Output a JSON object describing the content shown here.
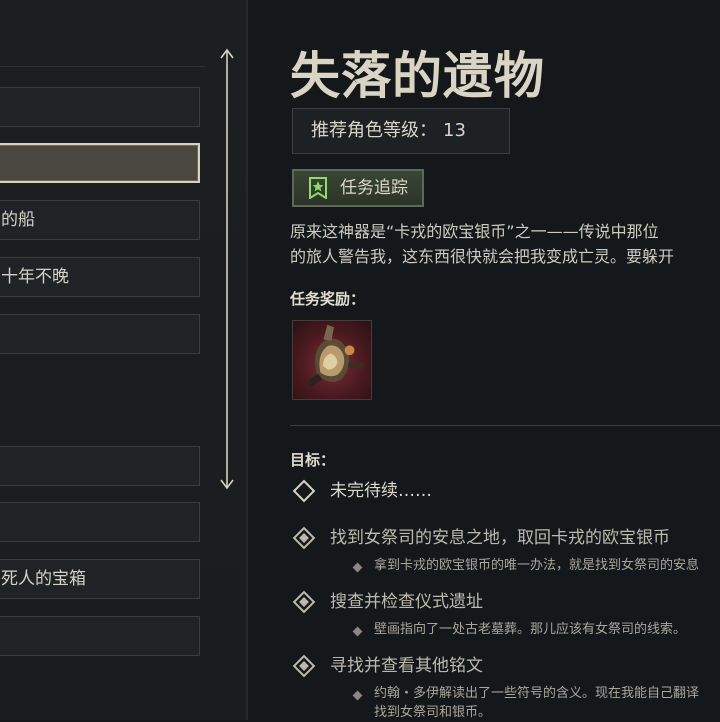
{
  "quest_list": {
    "items": [
      {
        "label": ""
      },
      {
        "label": ""
      },
      {
        "label": "的船"
      },
      {
        "label": "十年不晚"
      },
      {
        "label": ""
      },
      {
        "label": ""
      },
      {
        "label": ""
      },
      {
        "label": "死人的宝箱"
      },
      {
        "label": ""
      }
    ],
    "selected_index": 1
  },
  "quest": {
    "title": "失落的遗物",
    "level_label": "推荐角色等级：",
    "level_value": "13",
    "track_button": "任务追踪",
    "description_line1": "原来这神器是“卡戎的欧宝银币”之一——传说中那位",
    "description_line2": "的旅人警告我，这东西很快就会把我变成亡灵。要躲开",
    "rewards_label": "任务奖励：",
    "reward_icon": "coin-relic-icon",
    "objectives_label": "目标：",
    "objectives": [
      {
        "text": "未完待续……",
        "sub": ""
      },
      {
        "text": "找到女祭司的安息之地，取回卡戎的欧宝银币",
        "sub": "拿到卡戎的欧宝银币的唯一办法，就是找到女祭司的安息"
      },
      {
        "text": "搜查并检查仪式遗址",
        "sub": "壁画指向了一处古老墓葬。那儿应该有女祭司的线索。"
      },
      {
        "text": "寻找并查看其他铭文",
        "sub": "约翰・多伊解读出了一些符号的含义。现在我能自己翻译\n找到女祭司和银币。"
      }
    ]
  },
  "colors": {
    "background": "#15181a",
    "selected_item": "#4a4741",
    "track_button": "#3b4636",
    "reward_bg": "#7c2f36"
  }
}
